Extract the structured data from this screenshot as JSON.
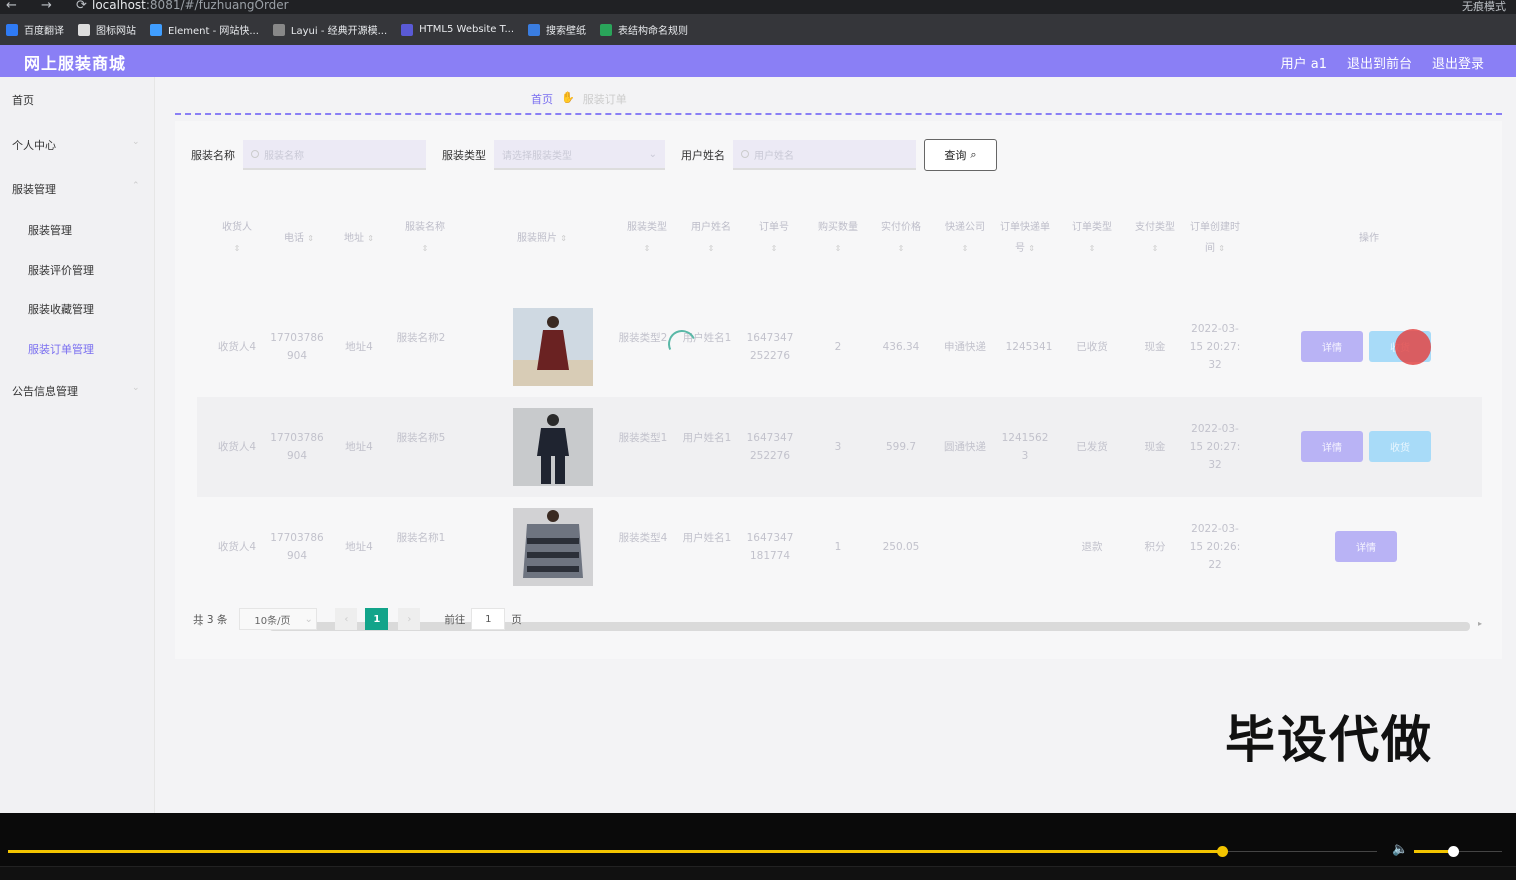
{
  "browser": {
    "url_host": "localhost",
    "url_path": ":8081/#/fuzhuangOrder",
    "mode_label": "无痕模式",
    "bookmarks": [
      "百度翻译",
      "图标网站",
      "Element - 网站快...",
      "Layui - 经典开源模...",
      "HTML5 Website T...",
      "搜索壁纸",
      "表结构命名规则"
    ]
  },
  "header": {
    "title": "网上服装商城",
    "user": "用户 a1",
    "to_front": "退出到前台",
    "logout": "退出登录"
  },
  "sidebar": {
    "home": "首页",
    "personal": "个人中心",
    "clothing_mgmt": "服装管理",
    "sub": [
      "服装管理",
      "服装评价管理",
      "服装收藏管理",
      "服装订单管理"
    ],
    "notice": "公告信息管理"
  },
  "breadcrumb": {
    "home": "首页",
    "current": "服装订单"
  },
  "search": {
    "name_label": "服装名称",
    "name_placeholder": "服装名称",
    "type_label": "服装类型",
    "type_placeholder": "请选择服装类型",
    "user_label": "用户姓名",
    "user_placeholder": "用户姓名",
    "query_btn": "查询"
  },
  "table": {
    "headers": [
      "收货人",
      "电话",
      "地址",
      "服装名称",
      "服装照片",
      "服装类型",
      "用户姓名",
      "订单号",
      "购买数量",
      "实付价格",
      "快递公司",
      "订单快递单号",
      "订单类型",
      "支付类型",
      "订单创建时间",
      "操作"
    ],
    "rows": [
      {
        "receiver": "收货人4",
        "phone": "17703786904",
        "address": "地址4",
        "name": "服装名称2",
        "type": "服装类型2",
        "user": "用户姓名1",
        "order_no": "1647347252276",
        "qty": "2",
        "price": "436.34",
        "courier": "申通快递",
        "tracking": "1245341",
        "status": "已收货",
        "pay": "现金",
        "time": "2022-03-15 20:27:32",
        "actions": [
          "详情",
          "收货"
        ]
      },
      {
        "receiver": "收货人4",
        "phone": "17703786904",
        "address": "地址4",
        "name": "服装名称5",
        "type": "服装类型1",
        "user": "用户姓名1",
        "order_no": "1647347252276",
        "qty": "3",
        "price": "599.7",
        "courier": "圆通快递",
        "tracking": "12415623",
        "status": "已发货",
        "pay": "现金",
        "time": "2022-03-15 20:27:32",
        "actions": [
          "详情",
          "收货"
        ]
      },
      {
        "receiver": "收货人4",
        "phone": "17703786904",
        "address": "地址4",
        "name": "服装名称1",
        "type": "服装类型4",
        "user": "用户姓名1",
        "order_no": "1647347181774",
        "qty": "1",
        "price": "250.05",
        "courier": "",
        "tracking": "",
        "status": "退款",
        "pay": "积分",
        "time": "2022-03-15 20:26:22",
        "actions": [
          "详情"
        ]
      }
    ]
  },
  "pagination": {
    "total": "共 3 条",
    "page_size": "10条/页",
    "current": "1",
    "goto": "前往",
    "goto_value": "1",
    "page_unit": "页"
  },
  "watermark": "毕设代做",
  "colors": {
    "header": "#8a7ff5",
    "accent": "#7a6ff0",
    "page_active": "#12a48a",
    "progress": "#f2c400"
  },
  "player": {
    "progress_fraction": 0.81,
    "volume_fraction": 0.45
  }
}
